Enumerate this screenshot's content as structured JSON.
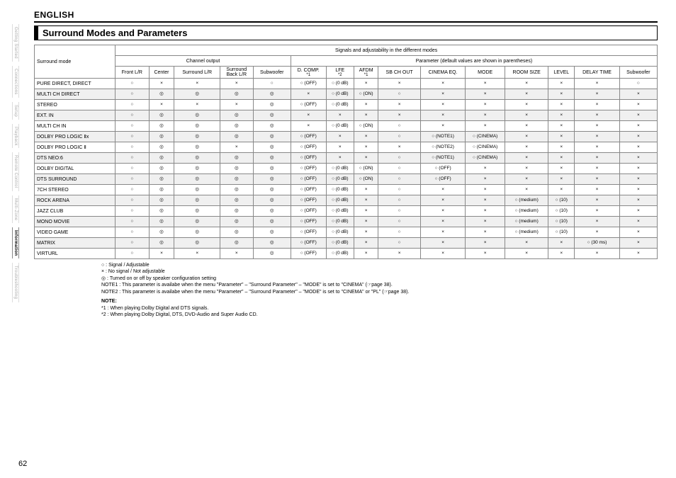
{
  "language": "ENGLISH",
  "page_number": "62",
  "sidebar": {
    "tabs": [
      "Getting Started",
      "Connections",
      "Setup",
      "Playback",
      "Remote Control",
      "Multi-Zone",
      "Information",
      "Troubleshooting"
    ],
    "active_index": 6
  },
  "section_title": "Surround Modes and Parameters",
  "headers": {
    "span_all": "Signals and adjustability in the different modes",
    "surround_mode": "Surround mode",
    "channel_output": "Channel output",
    "parameter_span": "Parameter (default values are shown in parentheses)",
    "channel_cols": [
      "Front L/R",
      "Center",
      "Surround L/R",
      "Surround Back L/R",
      "Subwoofer"
    ],
    "param_cols": [
      "D. COMP.",
      "LFE",
      "AFDM",
      "SB CH OUT",
      "CINEMA EQ.",
      "MODE",
      "ROOM SIZE",
      "LEVEL",
      "DELAY TIME",
      "Subwoofer"
    ],
    "star1": "*1",
    "star2": "*2"
  },
  "rows": [
    {
      "name": "PURE DIRECT, DIRECT",
      "ch": [
        "○",
        "×",
        "×",
        "×",
        "○"
      ],
      "p": [
        "○ (OFF)",
        "○ (0 dB)",
        "×",
        "×",
        "×",
        "×",
        "×",
        "×",
        "×",
        "○"
      ]
    },
    {
      "name": "MULTI CH DIRECT",
      "ch": [
        "○",
        "◎",
        "◎",
        "◎",
        "◎"
      ],
      "p": [
        "×",
        "○ (0 dB)",
        "○ (ON)",
        "○",
        "×",
        "×",
        "×",
        "×",
        "×",
        "×"
      ]
    },
    {
      "name": "STEREO",
      "ch": [
        "○",
        "×",
        "×",
        "×",
        "◎"
      ],
      "p": [
        "○ (OFF)",
        "○ (0 dB)",
        "×",
        "×",
        "×",
        "×",
        "×",
        "×",
        "×",
        "×"
      ]
    },
    {
      "name": "EXT. IN",
      "ch": [
        "○",
        "◎",
        "◎",
        "◎",
        "◎"
      ],
      "p": [
        "×",
        "×",
        "×",
        "×",
        "×",
        "×",
        "×",
        "×",
        "×",
        "×"
      ]
    },
    {
      "name": "MULTI CH IN",
      "ch": [
        "○",
        "◎",
        "◎",
        "◎",
        "◎"
      ],
      "p": [
        "×",
        "○ (0 dB)",
        "○ (ON)",
        "○",
        "×",
        "×",
        "×",
        "×",
        "×",
        "×"
      ]
    },
    {
      "name": "DOLBY PRO LOGIC Ⅱx",
      "ch": [
        "○",
        "◎",
        "◎",
        "◎",
        "◎"
      ],
      "p": [
        "○ (OFF)",
        "×",
        "×",
        "○",
        "○ (NOTE1)",
        "○ (CINEMA)",
        "×",
        "×",
        "×",
        "×"
      ]
    },
    {
      "name": "DOLBY PRO LOGIC Ⅱ",
      "ch": [
        "○",
        "◎",
        "◎",
        "×",
        "◎"
      ],
      "p": [
        "○ (OFF)",
        "×",
        "×",
        "×",
        "○ (NOTE2)",
        "○ (CINEMA)",
        "×",
        "×",
        "×",
        "×"
      ]
    },
    {
      "name": "DTS NEO:6",
      "ch": [
        "○",
        "◎",
        "◎",
        "◎",
        "◎"
      ],
      "p": [
        "○ (OFF)",
        "×",
        "×",
        "○",
        "○ (NOTE1)",
        "○ (CINEMA)",
        "×",
        "×",
        "×",
        "×"
      ]
    },
    {
      "name": "DOLBY DIGITAL",
      "ch": [
        "○",
        "◎",
        "◎",
        "◎",
        "◎"
      ],
      "p": [
        "○ (OFF)",
        "○ (0 dB)",
        "○ (ON)",
        "○",
        "○ (OFF)",
        "×",
        "×",
        "×",
        "×",
        "×"
      ]
    },
    {
      "name": "DTS SURROUND",
      "ch": [
        "○",
        "◎",
        "◎",
        "◎",
        "◎"
      ],
      "p": [
        "○ (OFF)",
        "○ (0 dB)",
        "○ (ON)",
        "○",
        "○ (OFF)",
        "×",
        "×",
        "×",
        "×",
        "×"
      ]
    },
    {
      "name": "7CH STEREO",
      "ch": [
        "○",
        "◎",
        "◎",
        "◎",
        "◎"
      ],
      "p": [
        "○ (OFF)",
        "○ (0 dB)",
        "×",
        "○",
        "×",
        "×",
        "×",
        "×",
        "×",
        "×"
      ]
    },
    {
      "name": "ROCK ARENA",
      "ch": [
        "○",
        "◎",
        "◎",
        "◎",
        "◎"
      ],
      "p": [
        "○ (OFF)",
        "○ (0 dB)",
        "×",
        "○",
        "×",
        "×",
        "○ (medium)",
        "○ (10)",
        "×",
        "×"
      ]
    },
    {
      "name": "JAZZ CLUB",
      "ch": [
        "○",
        "◎",
        "◎",
        "◎",
        "◎"
      ],
      "p": [
        "○ (OFF)",
        "○ (0 dB)",
        "×",
        "○",
        "×",
        "×",
        "○ (medium)",
        "○ (10)",
        "×",
        "×"
      ]
    },
    {
      "name": "MONO MOVIE",
      "ch": [
        "○",
        "◎",
        "◎",
        "◎",
        "◎"
      ],
      "p": [
        "○ (OFF)",
        "○ (0 dB)",
        "×",
        "○",
        "×",
        "×",
        "○ (medium)",
        "○ (10)",
        "×",
        "×"
      ]
    },
    {
      "name": "VIDEO GAME",
      "ch": [
        "○",
        "◎",
        "◎",
        "◎",
        "◎"
      ],
      "p": [
        "○ (OFF)",
        "○ (0 dB)",
        "×",
        "○",
        "×",
        "×",
        "○ (medium)",
        "○ (10)",
        "×",
        "×"
      ]
    },
    {
      "name": "MATRIX",
      "ch": [
        "○",
        "◎",
        "◎",
        "◎",
        "◎"
      ],
      "p": [
        "○ (OFF)",
        "○ (0 dB)",
        "×",
        "○",
        "×",
        "×",
        "×",
        "×",
        "○ (30 ms)",
        "×"
      ]
    },
    {
      "name": "VIRTURL",
      "ch": [
        "○",
        "×",
        "×",
        "×",
        "◎"
      ],
      "p": [
        "○ (OFF)",
        "○ (0 dB)",
        "×",
        "×",
        "×",
        "×",
        "×",
        "×",
        "×",
        "×"
      ]
    }
  ],
  "legend": {
    "l1": "○ :  Signal / Adjustable",
    "l2": "× :  No signal / Not adjustable",
    "l3": "◎ :  Turned on or off by speaker configuration setting",
    "n1": "NOTE1 : This parameter is availabe when the menu \"Parameter\" – \"Surround Parameter\" – \"MODE\" is set to \"CINEMA\" (☞page 38).",
    "n2": "NOTE2 : This parameter is availabe when the menu \"Parameter\" – \"Surround Parameter\" – \"MODE\" is set to \"CINEMA\" or \"PL\" (☞page 38)."
  },
  "footnote": {
    "title": "NOTE:",
    "f1": "*1 :      When playing Dolby Digital and DTS signals.",
    "f2": "*2 :      When playing Dolby Digital, DTS, DVD-Audio and Super Audio CD."
  }
}
